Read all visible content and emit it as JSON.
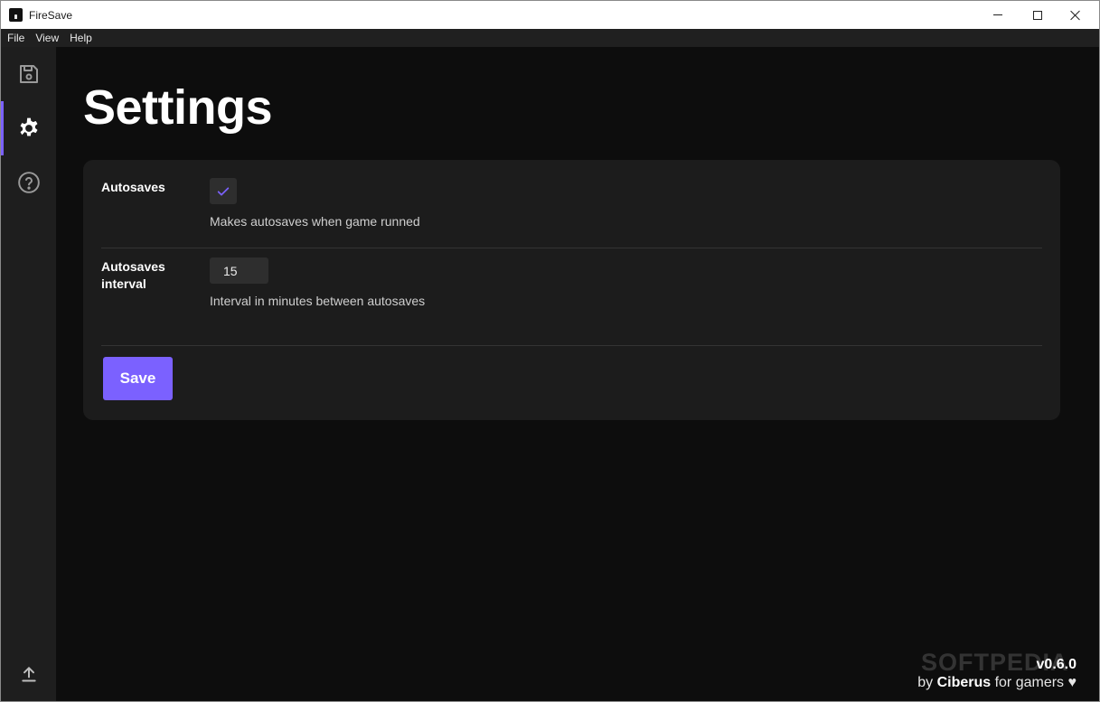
{
  "window": {
    "title": "FireSave"
  },
  "menu": {
    "items": [
      "File",
      "View",
      "Help"
    ]
  },
  "sidebar": {
    "items": [
      {
        "icon": "floppy-disk-icon",
        "active": false
      },
      {
        "icon": "gear-icon",
        "active": true
      },
      {
        "icon": "question-circle-icon",
        "active": false
      }
    ],
    "bottom_icon": "upload-icon"
  },
  "page": {
    "title": "Settings"
  },
  "settings": {
    "autosaves": {
      "label": "Autosaves",
      "checked": true,
      "description": "Makes autosaves when game runned"
    },
    "interval": {
      "label": "Autosaves interval",
      "value": "15",
      "description": "Interval in minutes between autosaves"
    },
    "save_label": "Save"
  },
  "footer": {
    "version": "v0.6.0",
    "credit_prefix": "by ",
    "credit_author": "Ciberus",
    "credit_suffix": " for gamers ♥"
  },
  "watermark": "SOFTPEDIA",
  "colors": {
    "accent": "#7b61ff",
    "background": "#0d0d0d",
    "card": "#1c1c1c",
    "sidebar": "#1e1e1e"
  }
}
